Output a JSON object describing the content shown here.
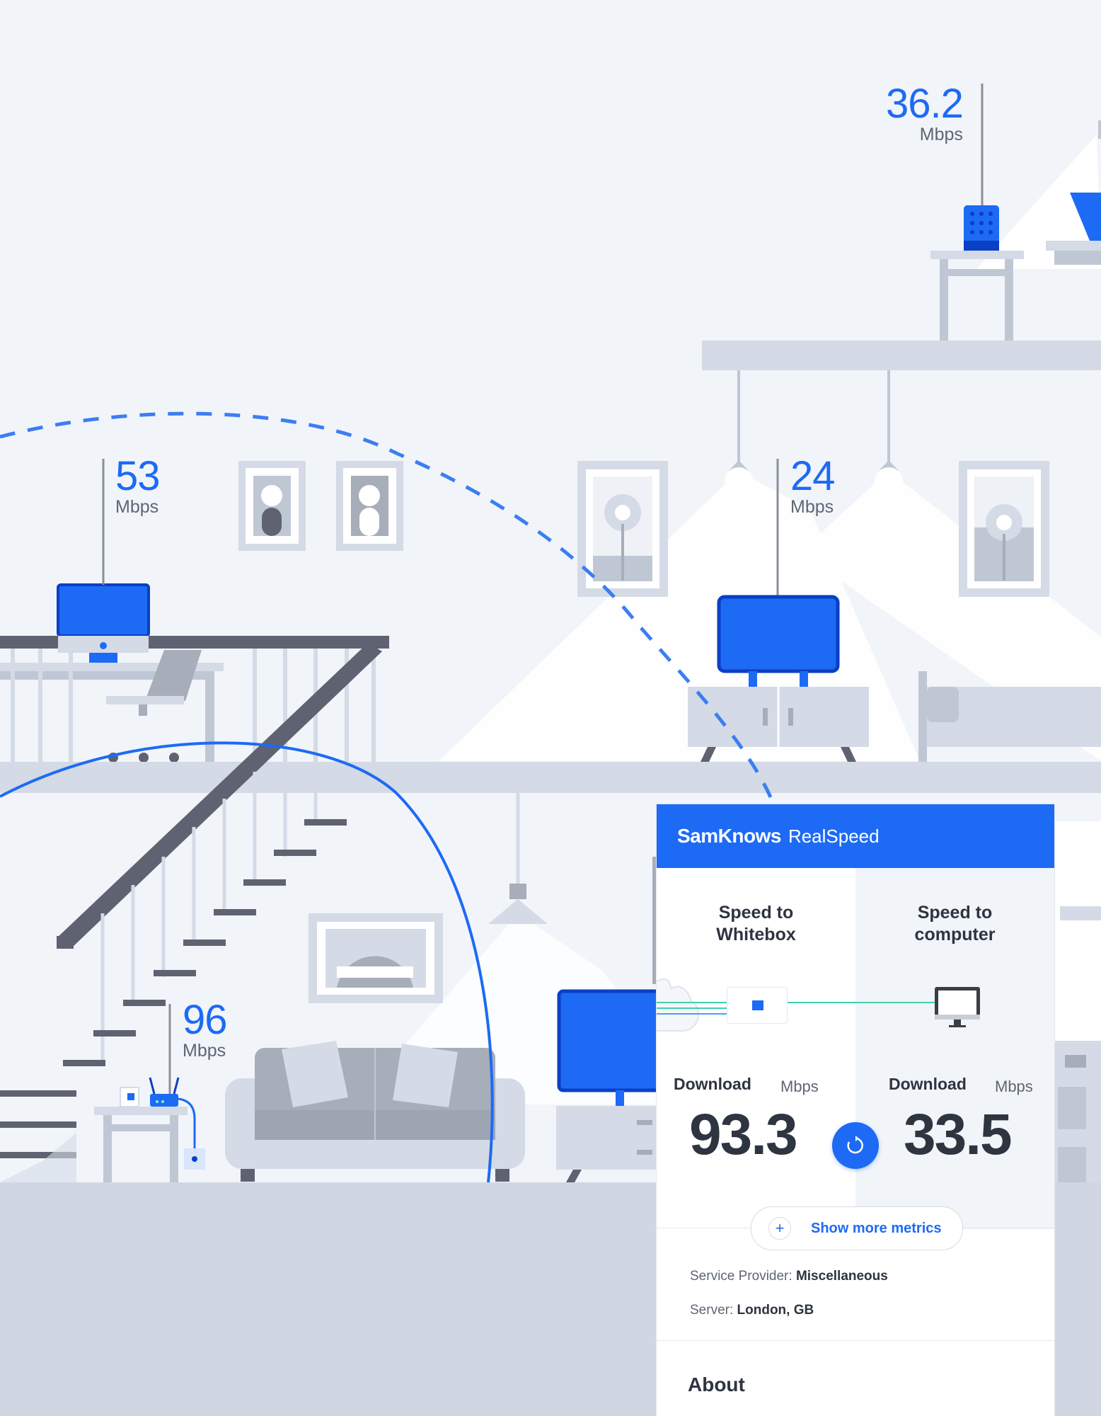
{
  "scene": {
    "speeds": [
      {
        "value": "36.2",
        "unit": "Mbps"
      },
      {
        "value": "53",
        "unit": "Mbps"
      },
      {
        "value": "24",
        "unit": "Mbps"
      },
      {
        "value": "96",
        "unit": "Mbps"
      }
    ]
  },
  "panel": {
    "brand": "SamKnows",
    "product": "RealSpeed",
    "left": {
      "title_line1": "Speed to",
      "title_line2": "Whitebox",
      "download_label": "Download",
      "unit": "Mbps",
      "value": "93.3"
    },
    "right": {
      "title_line1": "Speed to",
      "title_line2": "computer",
      "download_label": "Download",
      "unit": "Mbps",
      "value": "33.5"
    },
    "more_metrics": "Show more metrics",
    "provider_label": "Service Provider:",
    "provider_value": "Miscellaneous",
    "server_label": "Server:",
    "server_value": "London, GB",
    "about": "About"
  },
  "colors": {
    "accent": "#1d6af5",
    "background": "#f1f4f9",
    "floor": "#d0d7e3",
    "beams": "#d4dae6",
    "dark": "#5f6270"
  }
}
